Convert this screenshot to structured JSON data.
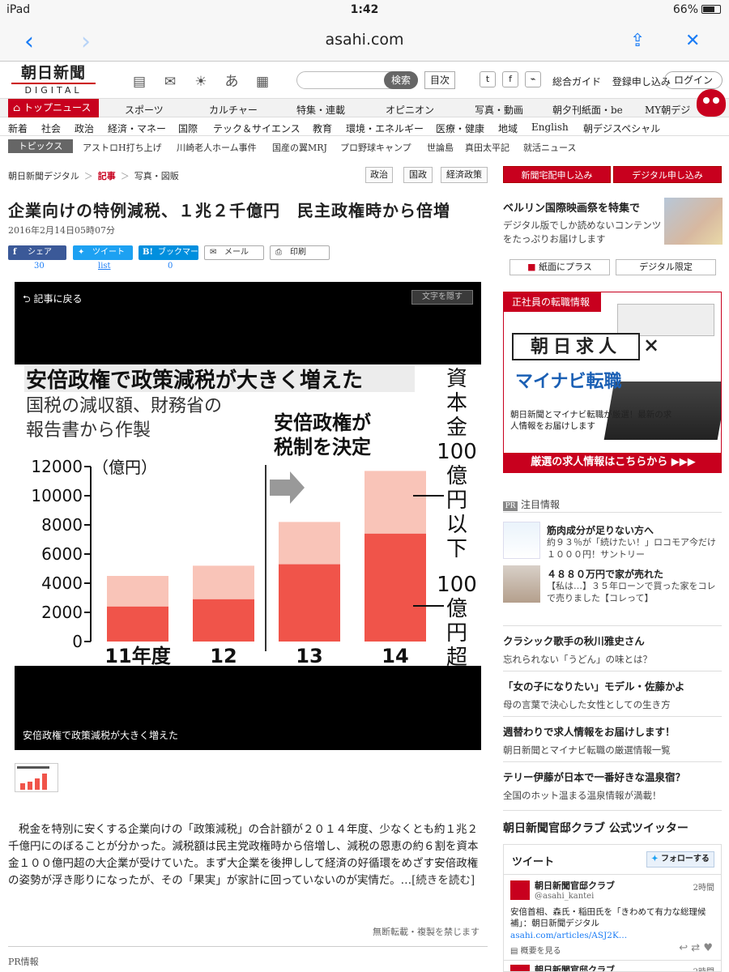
{
  "status": {
    "device": "iPad",
    "time": "1:42",
    "battery": "66%"
  },
  "browser": {
    "url": "asahi.com"
  },
  "masthead": {
    "logo_jp": "朝日新聞",
    "logo_en": "DIGITAL",
    "search_label": "検索",
    "mokuji": "目次",
    "guide": "総合ガイド",
    "register": "登録申し込み",
    "login": "ログイン"
  },
  "nav1": [
    "トップニュース",
    "スポーツ",
    "カルチャー",
    "特集・連載",
    "オピニオン",
    "写真・動画",
    "朝夕刊紙面・be",
    "MY朝デジ"
  ],
  "nav2": [
    "新着",
    "社会",
    "政治",
    "経済・マネー",
    "国際",
    "テック＆サイエンス",
    "教育",
    "環境・エネルギー",
    "医療・健康",
    "地域",
    "English",
    "朝デジスペシャル"
  ],
  "topics": {
    "label": "トピックス",
    "items": [
      "アストロH打ち上げ",
      "川崎老人ホーム事件",
      "国産の翼MRJ",
      "プロ野球キャンプ",
      "世論島",
      "真田太平記",
      "就活ニュース"
    ]
  },
  "breadcrumb": [
    "朝日新聞デジタル",
    "記事",
    "写真・図販"
  ],
  "tags": [
    "政治",
    "国政",
    "経済政策"
  ],
  "article": {
    "headline": "企業向けの特例減税、１兆２千億円　民主政権時から倍増",
    "date": "2016年2月14日05時07分",
    "share": {
      "facebook": "シェア",
      "facebook_count": "30",
      "twitter": "ツイート",
      "twitter_count": "list",
      "hatena": "ブックマーク",
      "hatena_count": "0",
      "mail": "メール",
      "print": "印刷"
    },
    "back": "記事に戻る",
    "hide_text": "文字を隠す",
    "caption": "安倍政権で政策減税が大きく増えた",
    "body": "税金を特別に安くする企業向けの「政策減税」の合計額が２０１４年度、少なくとも約１兆２千億円にのぼることが分かった。減税額は民主党政権時から倍増し、減税の恩恵の約６割を資本金１００億円超の大企業が受けていた。まず大企業を後押しして経済の好循環をめざす安倍政権の姿勢が浮き彫りになったが、その「果実」が家計に回っていないのが実情だ。",
    "readmore": "…[続きを読む]",
    "notice": "無断転載・複製を禁じます",
    "pr": "PR情報"
  },
  "chart_data": {
    "type": "bar",
    "title": "安倍政権で政策減税が大きく増えた",
    "subtitle_lines": [
      "国税の減収額、財務省の",
      "報告書から作製"
    ],
    "annotation": [
      "安倍政権が",
      "税制を決定"
    ],
    "unit": "（億円）",
    "categories": [
      "11年度",
      "12",
      "13",
      "14"
    ],
    "series": [
      {
        "name": "100億円超",
        "values": [
          2400,
          2900,
          5300,
          7400
        ],
        "color": "#f0544a"
      },
      {
        "name": "資本金100億円以下",
        "values": [
          2100,
          2300,
          2900,
          4300
        ],
        "color": "#f9c4b8"
      }
    ],
    "ylim": [
      0,
      12000
    ],
    "yticks": [
      "12000",
      "10000",
      "8000",
      "6000",
      "4000",
      "2000",
      "0"
    ],
    "legend_top": "資本金100億円以下",
    "legend_bottom": "100億円超"
  },
  "right": {
    "btn_paper": "新聞宅配申し込み",
    "btn_digital": "デジタル申し込み",
    "berlin_title": "ベルリン国際映画祭を特集で",
    "berlin_desc": "デジタル版でしか読めないコンテンツをたっぷりお届けします",
    "btn_plus": "紙面にプラス",
    "btn_limited": "デジタル限定",
    "ad": {
      "header": "正社員の転職情報",
      "kyujin": "朝日求人",
      "x": "×",
      "mynavi": "マイナビ転職",
      "desc": "朝日新聞とマイナビ転職が厳選！最新の求人情報をお届けします",
      "cta": "厳選の求人情報はこちらから ▶▶▶"
    },
    "attn_badge": "PR",
    "attn_title": "注目情報",
    "promos": [
      {
        "title": "筋肉成分が足りない方へ",
        "desc": "約９３％が「続けたい！」ロコモア今だけ１０００円！サントリー"
      },
      {
        "title": "４８８０万円で家が売れた",
        "desc": "【私は…】３５年ローンで買った家をコレで売りました【コレって】"
      }
    ],
    "list": [
      {
        "title": "クラシック歌手の秋川雅史さん",
        "desc": "忘れられない「うどん」の味とは？"
      },
      {
        "title": "「女の子になりたい」モデル・佐藤かよ",
        "desc": "母の言葉で決心した女性としての生き方"
      },
      {
        "title": "週替わりで求人情報をお届けします！",
        "desc": "朝日新聞とマイナビ転職の厳選情報一覧"
      },
      {
        "title": "テリー伊藤が日本で一番好きな温泉宿？",
        "desc": "全国のホット温まる温泉情報が満載！"
      }
    ],
    "club_title": "朝日新聞官邸クラブ 公式ツイッター",
    "tweets": {
      "header": "ツイート",
      "follow": "フォローする",
      "name": "朝日新聞官邸クラブ",
      "handle": "@asahi_kantei",
      "time": "2時間",
      "text": "安倍首相、森氏・稲田氏を「きわめて有力な総理候補」：朝日新聞デジタル",
      "link": "asahi.com/articles/ASJ2K…",
      "summary": "概要を見る",
      "name2": "朝日新聞官邸クラブ",
      "time2": "2時間"
    }
  }
}
